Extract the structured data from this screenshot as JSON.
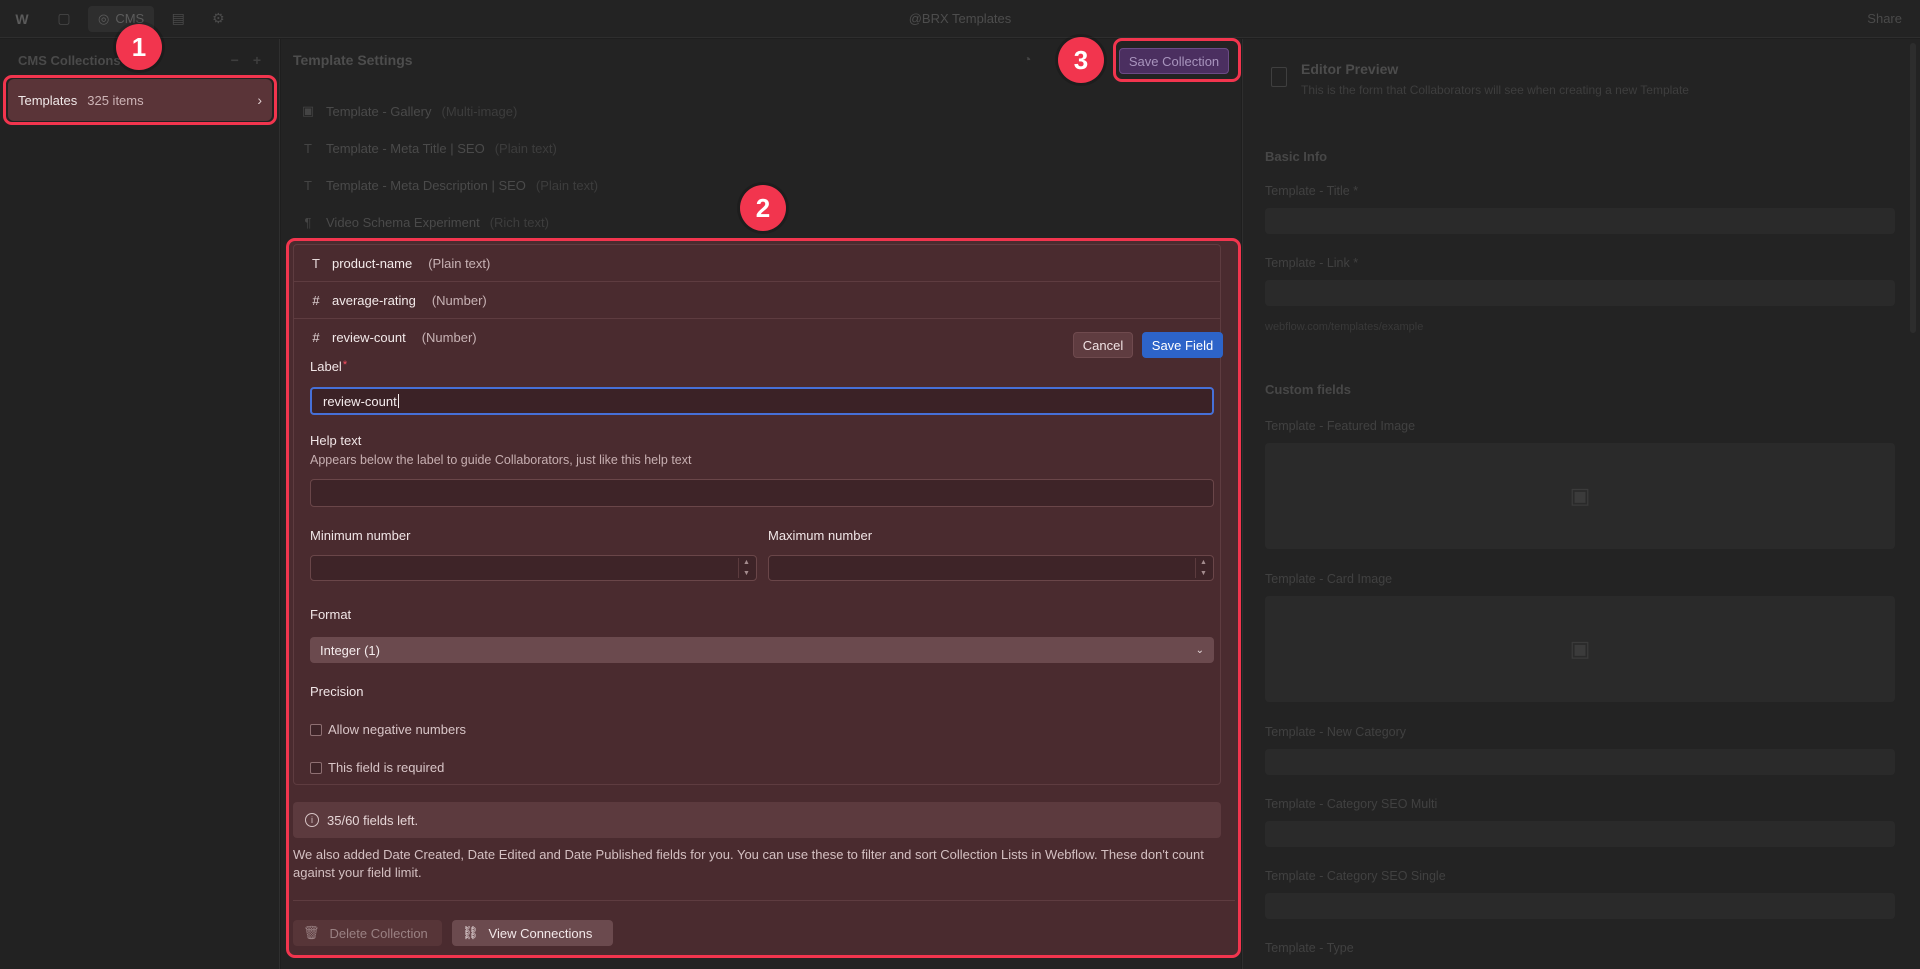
{
  "topbar": {
    "logo": "W",
    "cms_label": "CMS",
    "title": "@BRX Templates",
    "share": "Share"
  },
  "left_panel": {
    "header": "CMS Collections",
    "collection": {
      "name": "Templates",
      "count": "325 items"
    }
  },
  "mid_panel": {
    "header": "Template Settings",
    "save_collection": "Save Collection",
    "dim_fields": [
      {
        "name": "Template - Gallery",
        "type": "(Multi-image)",
        "icon": "gallery-icon"
      },
      {
        "name": "Template - Meta Title | SEO",
        "type": "(Plain text)",
        "icon": "text-icon"
      },
      {
        "name": "Template - Meta Description | SEO",
        "type": "(Plain text)",
        "icon": "text-icon"
      },
      {
        "name": "Video Schema Experiment",
        "type": "(Rich text)",
        "icon": "richtext-icon"
      }
    ]
  },
  "editor": {
    "fields": [
      {
        "name": "product-name",
        "type": "(Plain text)",
        "icon": "text-icon"
      },
      {
        "name": "average-rating",
        "type": "(Number)",
        "icon": "hash-icon"
      },
      {
        "name": "review-count",
        "type": "(Number)",
        "icon": "hash-icon"
      }
    ],
    "cancel": "Cancel",
    "save_field": "Save Field",
    "label_title": "Label",
    "label_required": "*",
    "label_value": "review-count",
    "help_title": "Help text",
    "help_desc": "Appears below the label to guide Collaborators, just like this help text",
    "help_value": "",
    "min_title": "Minimum number",
    "max_title": "Maximum number",
    "format_title": "Format",
    "format_value": "Integer (1)",
    "precision_title": "Precision",
    "allow_negative": "Allow negative numbers",
    "required": "This field is required",
    "fields_left": "35/60 fields left.",
    "note": "We also added Date Created, Date Edited and Date Published fields for you. You can use these to filter and sort Collection Lists in Webflow. These don't count against your field limit.",
    "delete_collection": "Delete Collection",
    "view_connections": "View Connections"
  },
  "right_panel": {
    "title": "Editor Preview",
    "subtitle": "This is the form that Collaborators will see when creating a new Template",
    "basic_info": "Basic Info",
    "title_field": "Template - Title *",
    "link_field": "Template - Link *",
    "slug_hint": "webflow.com/templates/example",
    "custom_fields": "Custom fields",
    "featured_image": "Template - Featured Image",
    "card_image": "Template - Card Image",
    "new_category": "Template - New Category",
    "category_multi": "Template - Category SEO Multi",
    "category_single": "Template - Category SEO Single",
    "type": "Template - Type"
  },
  "badges": [
    "1",
    "2",
    "3"
  ],
  "colors": {
    "highlight": "#f2354e",
    "editor_bg": "#4a2b2f",
    "save_field_blue": "#2d64c9",
    "save_collection_purple": "#4b2f60"
  }
}
